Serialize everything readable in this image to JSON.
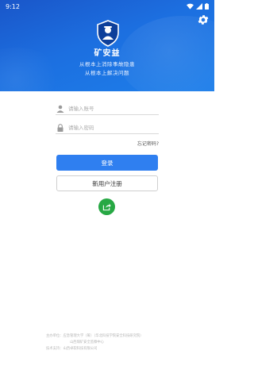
{
  "status_bar": {
    "time": "9:12"
  },
  "brand": {
    "name": "矿安益"
  },
  "slogan": {
    "line1": "从根本上消除事故隐患",
    "line2": "从根本上解决问题"
  },
  "login": {
    "account_placeholder": "请输入账号",
    "password_placeholder": "请输入密码",
    "forgot_label": "忘记密码?",
    "login_label": "登录",
    "register_label": "新用户注册"
  },
  "footer": {
    "line1": "主办单位：应急管理大学（筹）（华北科技学院安全科技研究院）",
    "line2": "山西煤矿安全监察中心",
    "line3": "技术支持：山西卓软科技有限公司"
  },
  "colors": {
    "header": "#1c6fe0",
    "primary": "#2f7ff0",
    "share": "#27a844"
  },
  "icons": [
    "wifi-icon",
    "signal-icon",
    "battery-icon",
    "settings-gear-icon",
    "shield-logo-icon",
    "user-icon",
    "lock-icon",
    "share-icon"
  ]
}
